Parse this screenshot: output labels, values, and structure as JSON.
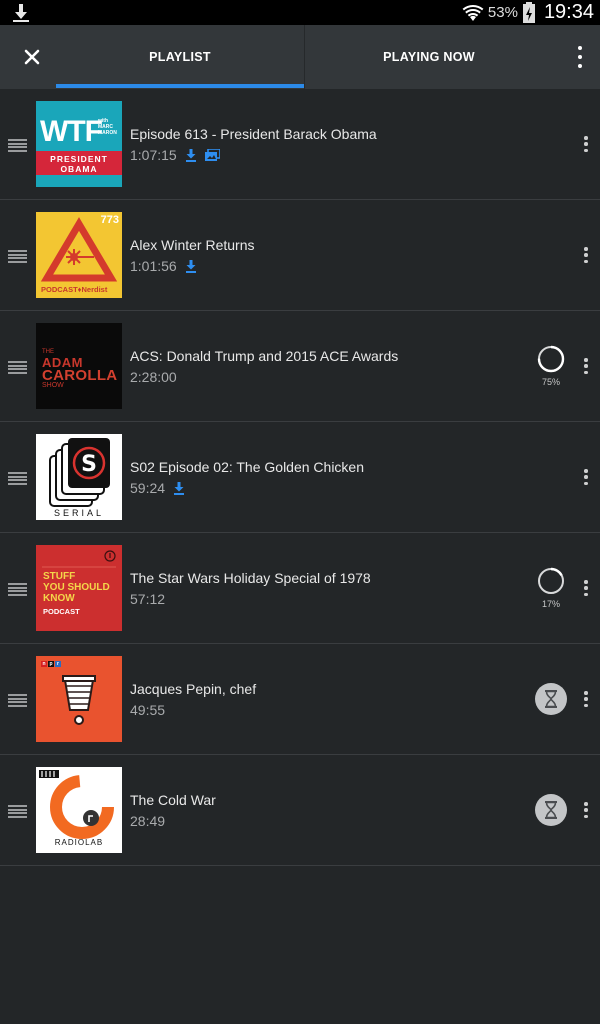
{
  "status_bar": {
    "battery_percent": "53%",
    "time": "19:34"
  },
  "toolbar": {
    "tabs": [
      {
        "label": "PLAYLIST",
        "selected": true
      },
      {
        "label": "PLAYING NOW",
        "selected": false
      }
    ],
    "accent_color": "#2c8ae8"
  },
  "playlist": {
    "items": [
      {
        "title": "Episode 613 - President Barack Obama",
        "duration": "1:07:15",
        "downloaded": true,
        "has_video": true,
        "status": "",
        "artwork": {
          "logo": "WTF",
          "small": "with MARC MARON",
          "line1": "PRESIDENT",
          "line2": "OBAMA"
        }
      },
      {
        "title": "Alex Winter Returns",
        "duration": "1:01:56",
        "downloaded": true,
        "status": "",
        "artwork": {
          "number": "773",
          "label": "PODCAST♦Nerdist"
        }
      },
      {
        "title": "ACS: Donald Trump and 2015 ACE Awards",
        "duration": "2:28:00",
        "downloaded": false,
        "status": "downloading",
        "progress_label": "75%",
        "progress": 0.75,
        "artwork": {
          "the": "THE",
          "adam": "ADAM",
          "carolla": "CAROLLA",
          "show": "SHOW"
        }
      },
      {
        "title": "S02 Episode 02: The Golden Chicken",
        "duration": "59:24",
        "downloaded": true,
        "status": "",
        "artwork": {
          "word": "SERIAL"
        }
      },
      {
        "title": "The Star Wars Holiday Special of 1978",
        "duration": "57:12",
        "downloaded": false,
        "status": "downloading",
        "progress_label": "17%",
        "progress": 0.17,
        "artwork": {
          "line1": "STUFF",
          "line2": "YOU SHOULD",
          "line3": "KNOW",
          "line4": "PODCAST"
        }
      },
      {
        "title": "Jacques Pepin, chef",
        "duration": "49:55",
        "downloaded": false,
        "status": "queued",
        "artwork": {
          "logo": "npr"
        }
      },
      {
        "title": "The Cold War",
        "duration": "28:49",
        "downloaded": false,
        "status": "queued",
        "artwork": {
          "word": "RADIOLAB"
        }
      }
    ]
  }
}
